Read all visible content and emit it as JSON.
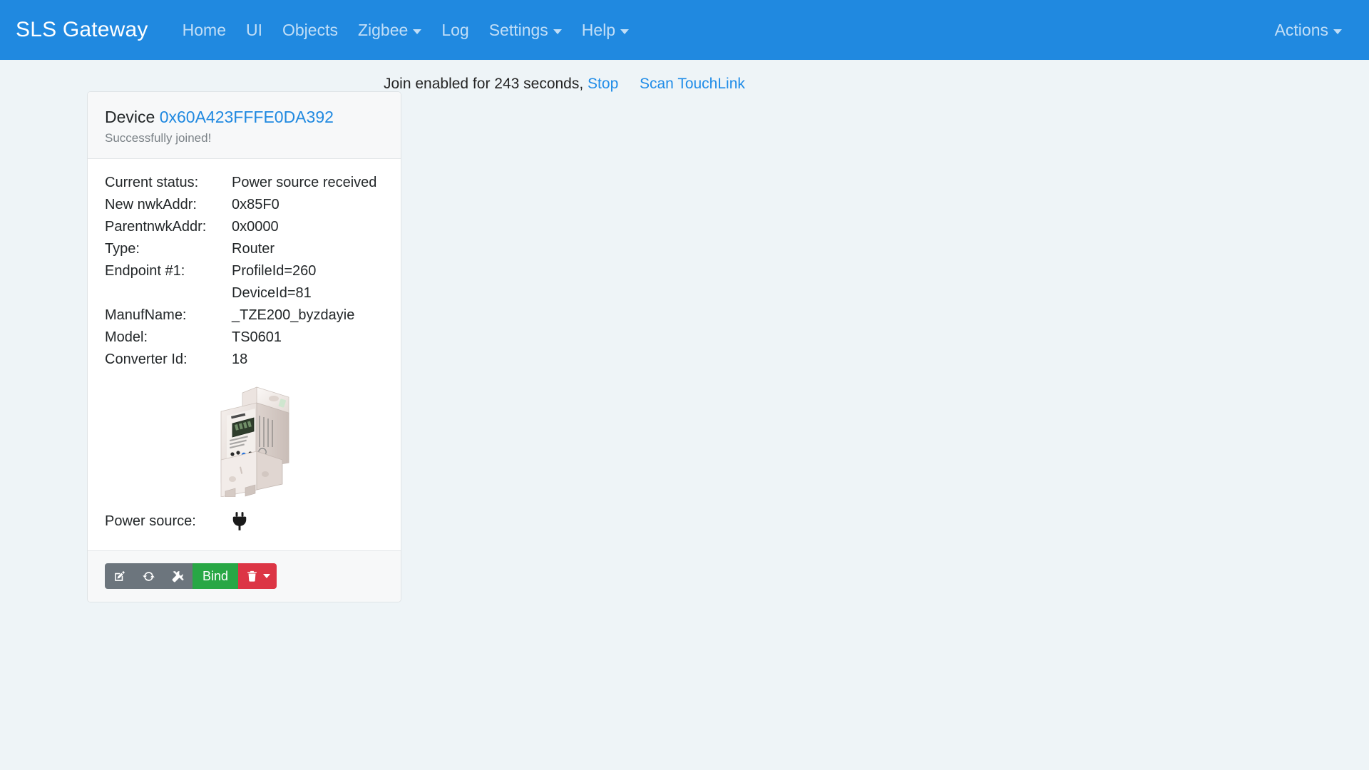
{
  "navbar": {
    "brand": "SLS Gateway",
    "items": [
      {
        "label": "Home",
        "dropdown": false
      },
      {
        "label": "UI",
        "dropdown": false
      },
      {
        "label": "Objects",
        "dropdown": false
      },
      {
        "label": "Zigbee",
        "dropdown": true
      },
      {
        "label": "Log",
        "dropdown": false
      },
      {
        "label": "Settings",
        "dropdown": true
      },
      {
        "label": "Help",
        "dropdown": true
      }
    ],
    "right": {
      "label": "Actions",
      "dropdown": true
    },
    "bg_color": "#2089e0"
  },
  "statusbar": {
    "join_text": "Join enabled for 243 seconds,",
    "stop_label": "Stop",
    "scan_touchlink_label": "Scan TouchLink",
    "seconds_remaining": 243
  },
  "device_card": {
    "title_prefix": "Device",
    "address": "0x60A423FFFE0DA392",
    "subtitle": "Successfully joined!",
    "properties": [
      {
        "label": "Current status:",
        "value": "Power source received"
      },
      {
        "label": "New nwkAddr:",
        "value": "0x85F0"
      },
      {
        "label": "ParentnwkAddr:",
        "value": "0x0000"
      },
      {
        "label": "Type:",
        "value": "Router"
      },
      {
        "label": "Endpoint #1:",
        "value": "ProfileId=260"
      },
      {
        "label": "",
        "value": "DeviceId=81"
      },
      {
        "label": "ManufName:",
        "value": "_TZE200_byzdayie"
      },
      {
        "label": "Model:",
        "value": "TS0601"
      },
      {
        "label": "Converter Id:",
        "value": "18"
      }
    ],
    "image_alt": "din-rail-energy-meter",
    "power_source": {
      "label": "Power source:",
      "icon": "mains-plug-icon"
    },
    "actions": [
      {
        "name": "edit-button",
        "icon": "edit-icon",
        "label": "",
        "style": "secondary"
      },
      {
        "name": "refresh-button",
        "icon": "refresh-icon",
        "label": "",
        "style": "secondary"
      },
      {
        "name": "tools-button",
        "icon": "tools-icon",
        "label": "",
        "style": "secondary"
      },
      {
        "name": "bind-button",
        "icon": "",
        "label": "Bind",
        "style": "success"
      },
      {
        "name": "delete-button",
        "icon": "trash-icon",
        "label": "",
        "style": "danger",
        "dropdown": true
      }
    ]
  },
  "colors": {
    "brand_blue": "#2089e0",
    "link_blue": "#1f8ce8",
    "page_bg": "#eef4f7",
    "success_green": "#28a745",
    "danger_red": "#dc3545",
    "secondary_gray": "#6c757d"
  }
}
